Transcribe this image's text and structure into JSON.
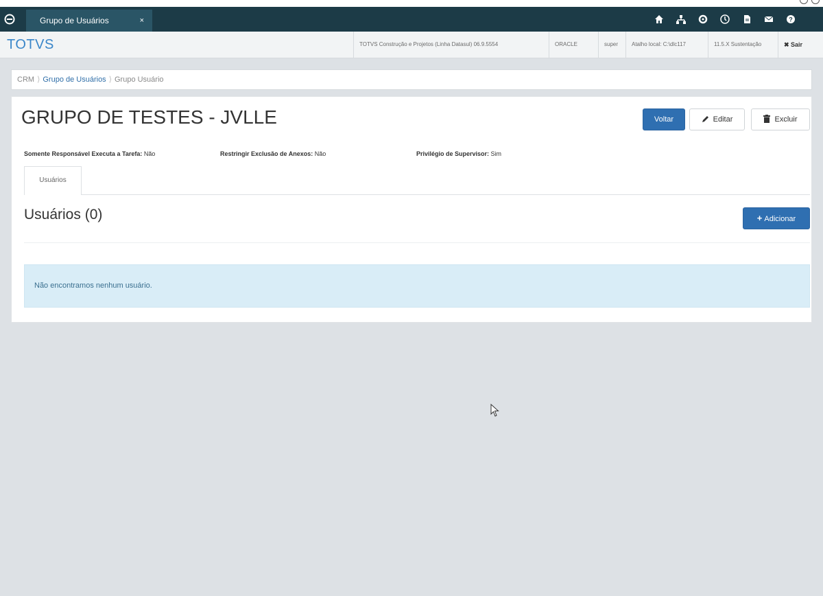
{
  "browser": {
    "icons": [
      "profile-icon",
      "browser-menu-icon"
    ]
  },
  "menubar": {
    "tab_label": "Grupo de Usuários",
    "tab_close": "×",
    "icons": [
      "home-icon",
      "sitemap-icon",
      "settings-icon",
      "clock-icon",
      "document-icon",
      "mail-icon",
      "help-icon"
    ]
  },
  "header": {
    "brand": "TOTVS",
    "product": "TOTVS Construção e Projetos (Linha Datasul) 06.9.5554",
    "database": "ORACLE",
    "user": "super",
    "shortcut": "Atalho local: C:\\dlc117",
    "version": "11.5.X Sustentação",
    "logout": "✖ Sair"
  },
  "breadcrumb": {
    "root": "CRM",
    "parent": "Grupo de Usuários",
    "current": "Grupo Usuário"
  },
  "page": {
    "title": "GRUPO DE TESTES - JVLLE",
    "buttons": {
      "back": "Voltar",
      "edit": "Editar",
      "delete": "Excluir"
    },
    "properties": [
      {
        "label": "Somente Responsável Executa a Tarefa:",
        "value": "Não"
      },
      {
        "label": "Restringir Exclusão de Anexos:",
        "value": "Não"
      },
      {
        "label": "Privilégio de Supervisor:",
        "value": "Sim"
      }
    ],
    "tabs": [
      "Usuários"
    ],
    "users_heading": "Usuários (0)",
    "add_button": "Adicionar",
    "empty_message": "Não encontramos nenhum usuário."
  },
  "colors": {
    "menubar": "#1c3b47",
    "active_tab": "#2a5566",
    "primary": "#2f6fb1",
    "brand": "#3a86c9",
    "alert_bg": "#d9edf7",
    "background": "#dde1e5"
  }
}
